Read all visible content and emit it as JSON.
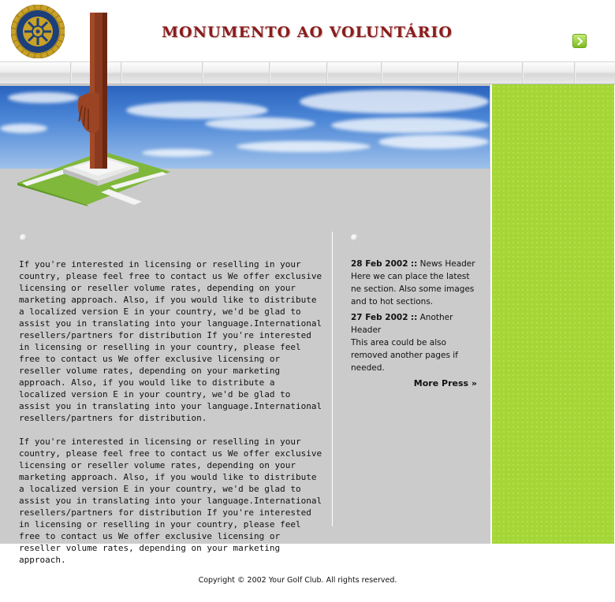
{
  "header": {
    "title": "MONUMENTO AO VOLUNTÁRIO",
    "logo_text": "ROTARY INTERNATIONAL",
    "go_button_icon": "chevron-right-icon"
  },
  "navbar": {
    "segments": 10
  },
  "main": {
    "paragraphs": [
      "If you're interested in licensing or reselling  in your country, please feel free to contact us We offer exclusive licensing or reseller volume rates, depending on your marketing approach. Also, if you would like to distribute a localized version E in your country, we'd be glad to assist you in translating  into your language.International resellers/partners for distribution If you're interested in licensing or reselling  in your country, please feel free to contact us We offer exclusive licensing or reseller volume rates, depending on your marketing approach. Also, if you would like to distribute a localized version E in your country, we'd be glad to assist you in translating  into your language.International resellers/partners for distribution.",
      "If you're interested in licensing or reselling  in your country, please feel free to contact us We offer exclusive licensing or reseller volume rates, depending on your marketing approach. Also, if you would like to distribute a localized version E in your country, we'd be glad to assist you in translating  into your language.International resellers/partners for distribution If you're interested in licensing or reselling  in your country, please feel free to contact us We offer exclusive licensing or reseller volume rates, depending on your marketing approach."
    ]
  },
  "news": {
    "items": [
      {
        "date": "28 Feb 2002",
        "separator": "::",
        "header": "News Header",
        "body": "Here we can place the latest ne section. Also some images and to hot sections."
      },
      {
        "date": "27 Feb 2002",
        "separator": "::",
        "header": "Another Header",
        "body": "This area could be also removed another pages if needed."
      }
    ],
    "more_label": "More Press »"
  },
  "footer": {
    "copyright": "Copyright © 2002 Your Golf Club. All rights reserved."
  },
  "colors": {
    "title": "#8a1c1c",
    "main_bg": "#cbcbcb",
    "side_green": "#a5d637",
    "sky_blue": "#3f78cf"
  }
}
